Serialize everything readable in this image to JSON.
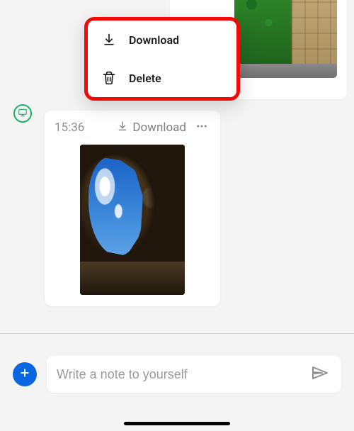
{
  "context_menu": {
    "download_label": "Download",
    "delete_label": "Delete"
  },
  "message2": {
    "time": "15:36",
    "download_label": "Download"
  },
  "composer": {
    "placeholder": "Write a note to yourself"
  }
}
